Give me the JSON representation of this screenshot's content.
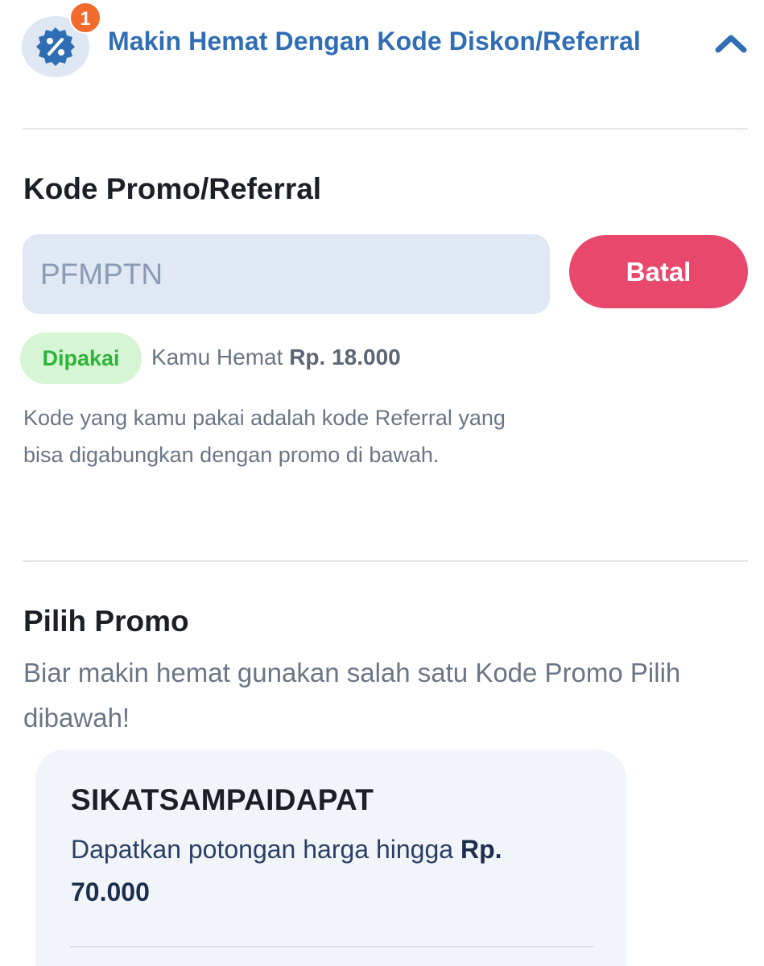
{
  "header": {
    "badge_count": "1",
    "title": "Makin Hemat Dengan Kode Diskon/Referral",
    "icon": "discount-percent-icon",
    "chevron": "chevron-up-icon"
  },
  "promo_code": {
    "title": "Kode Promo/Referral",
    "input_value": "PFMPTN",
    "cancel_label": "Batal",
    "status_label": "Dipakai",
    "savings_prefix": "Kamu Hemat",
    "savings_amount": "Rp. 18.000",
    "info": "Kode yang kamu pakai adalah kode Referral yang bisa digabungkan dengan promo di bawah."
  },
  "choose_promo": {
    "title": "Pilih Promo",
    "subtitle": "Biar makin hemat gunakan salah satu Kode Promo Pilih dibawah!",
    "cards": [
      {
        "code": "SIKATSAMPAIDAPAT",
        "desc_prefix": "Dapatkan potongan harga hingga",
        "desc_amount": "Rp. 70.000"
      }
    ]
  },
  "colors": {
    "accent_blue": "#2f6db5",
    "cancel_red": "#e8486c",
    "badge_orange": "#f26a2c",
    "success_green": "#2fb43a"
  }
}
